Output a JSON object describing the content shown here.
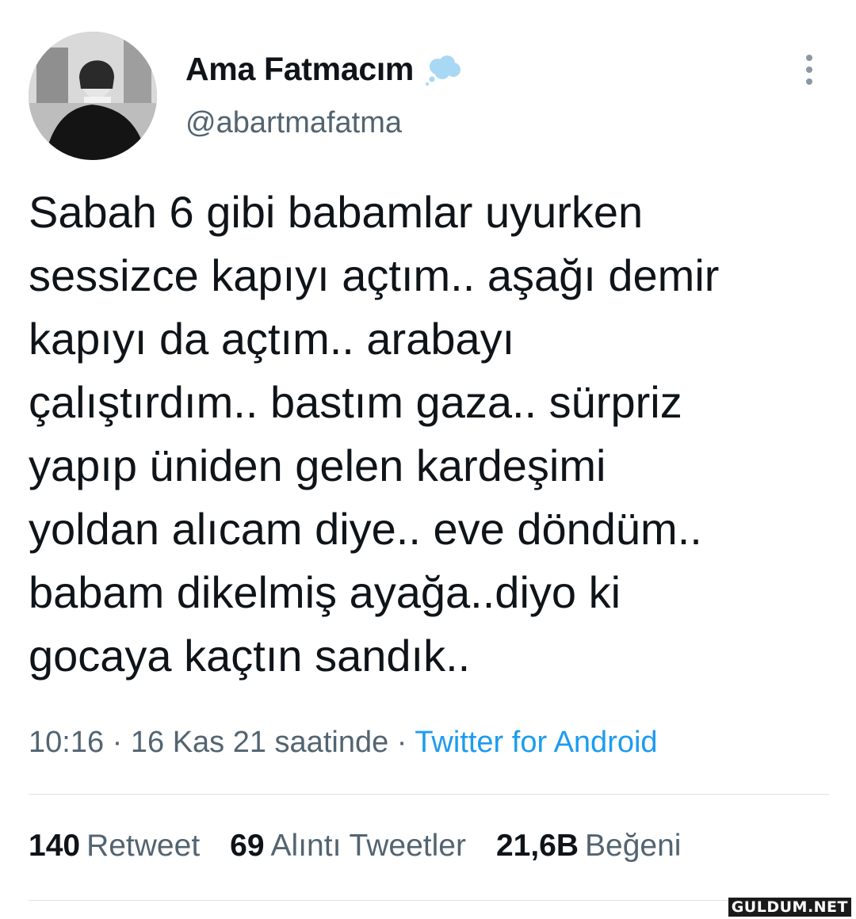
{
  "user": {
    "display_name": "Ama Fatmacım",
    "handle": "@abartmafatma",
    "badge_icon": "thought-bubble-icon",
    "avatar_icon": "profile-photo"
  },
  "tweet": {
    "lines": [
      "Sabah 6 gibi babamlar uyurken",
      "sessizce kapıyı açtım.. aşağı demir",
      "kapıyı da açtım.. arabayı",
      "çalıştırdım.. bastım gaza.. sürpriz",
      "yapıp üniden gelen kardeşimi",
      "yoldan alıcam diye.. eve döndüm..",
      "babam dikelmiş ayağa..diyo ki",
      "gocaya kaçtın sandık.."
    ],
    "timestamp": "10:16 · 16 Kas 21 saatinde · ",
    "source": "Twitter for Android"
  },
  "stats": {
    "retweets_count": "140",
    "retweets_label": "Retweet",
    "quotes_count": "69",
    "quotes_label": "Alıntı Tweetler",
    "likes_count": "21,6B",
    "likes_label": "Beğeni"
  },
  "watermark": "GULDUM.NET",
  "colors": {
    "text": "#0f1419",
    "secondary": "#536471",
    "link": "#1d9bf0",
    "badge": "#a9d8f5"
  },
  "more_icon": "more-vertical-icon"
}
